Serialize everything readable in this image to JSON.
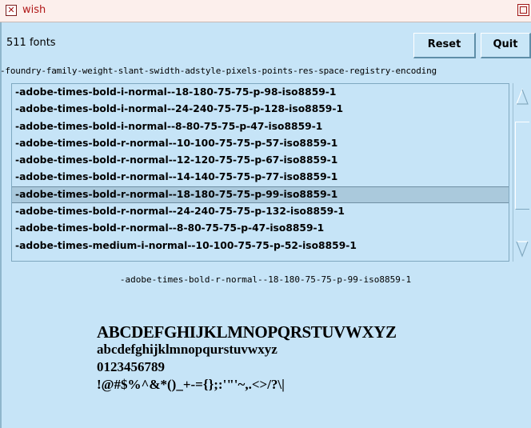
{
  "window": {
    "title": "wish"
  },
  "status": {
    "font_count": "511 fonts"
  },
  "buttons": {
    "reset": "Reset",
    "quit": "Quit"
  },
  "header": "-foundry-family-weight-slant-swidth-adstyle-pixels-points-res-space-registry-encoding",
  "fonts": [
    "-adobe-times-bold-i-normal--18-180-75-75-p-98-iso8859-1",
    "-adobe-times-bold-i-normal--24-240-75-75-p-128-iso8859-1",
    "-adobe-times-bold-i-normal--8-80-75-75-p-47-iso8859-1",
    "-adobe-times-bold-r-normal--10-100-75-75-p-57-iso8859-1",
    "-adobe-times-bold-r-normal--12-120-75-75-p-67-iso8859-1",
    "-adobe-times-bold-r-normal--14-140-75-75-p-77-iso8859-1",
    "-adobe-times-bold-r-normal--18-180-75-75-p-99-iso8859-1",
    "-adobe-times-bold-r-normal--24-240-75-75-p-132-iso8859-1",
    "-adobe-times-bold-r-normal--8-80-75-75-p-47-iso8859-1",
    "-adobe-times-medium-i-normal--10-100-75-75-p-52-iso8859-1"
  ],
  "selected_index": 6,
  "preview": {
    "caption": "-adobe-times-bold-r-normal--18-180-75-75-p-99-iso8859-1",
    "uppercase": "ABCDEFGHIJKLMNOPQRSTUVWXYZ",
    "lowercase": "abcdefghijklmnopqurstuvwxyz",
    "digits": "0123456789",
    "symbols": "!@#$%^&*()_+-={};:'\"'~,.<>/?\\|"
  },
  "icons": {
    "close": "close-box-icon",
    "maximize": "maximize-icon",
    "scroll_up": "scroll-up-arrow-icon",
    "scroll_down": "scroll-down-arrow-icon"
  }
}
